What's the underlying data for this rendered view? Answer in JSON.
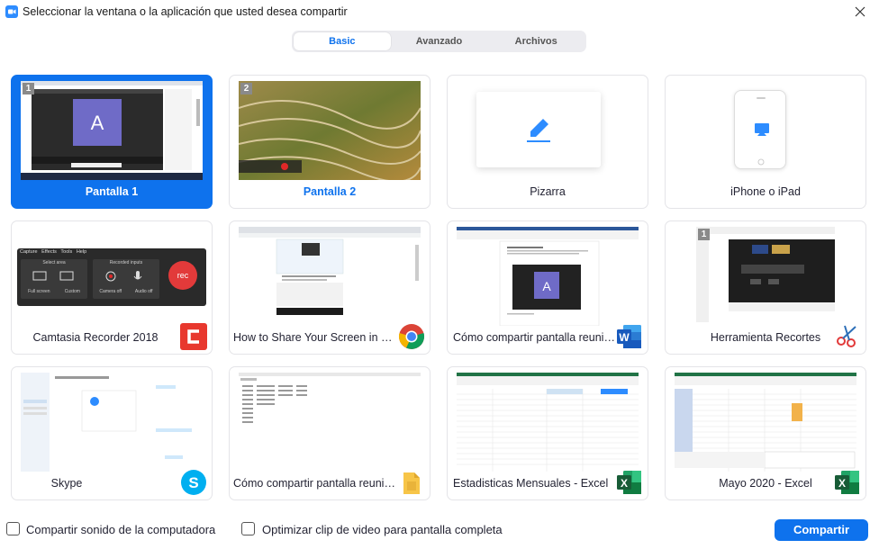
{
  "window": {
    "title": "Seleccionar la ventana o la aplicación que usted desea compartir",
    "accent_color": "#0e72ed"
  },
  "tabs": [
    {
      "label": "Basic",
      "active": true
    },
    {
      "label": "Avanzado",
      "active": false
    },
    {
      "label": "Archivos",
      "active": false
    }
  ],
  "cards": [
    {
      "label": "Pantalla 1",
      "number": "1",
      "selected": true
    },
    {
      "label": "Pantalla 2",
      "number": "2",
      "selected": false
    },
    {
      "label": "Pizarra",
      "icon": "pencil-icon"
    },
    {
      "label": "iPhone o iPad",
      "icon": "airplay-icon"
    },
    {
      "label": "Camtasia Recorder 2018",
      "app_icon": "camtasia-icon",
      "recorder": {
        "menu": [
          "Capture",
          "Effects",
          "Tools",
          "Help"
        ],
        "select_area": "Select area",
        "recorded_inputs": "Recorded inputs",
        "full_screen": "Full screen",
        "custom": "Custom",
        "camera": "Camera off",
        "audio": "Audio off",
        "rec": "rec"
      }
    },
    {
      "label": "How to Share Your Screen in a Zo...",
      "app_icon": "chrome-icon"
    },
    {
      "label": "Cómo compartir pantalla reunio...",
      "app_icon": "word-icon"
    },
    {
      "label": "Herramienta Recortes",
      "number": "1",
      "app_icon": "snipping-tool-icon"
    },
    {
      "label": "Skype",
      "app_icon": "skype-icon"
    },
    {
      "label": "Cómo compartir pantalla reunio...",
      "app_icon": "folder-icon"
    },
    {
      "label": "Estadisticas Mensuales - Excel",
      "app_icon": "excel-icon"
    },
    {
      "label": "Mayo 2020 - Excel",
      "app_icon": "excel-icon"
    }
  ],
  "footer": {
    "share_sound_label": "Compartir sonido de la computadora",
    "share_sound_checked": false,
    "optimize_video_label": "Optimizar clip de video para pantalla completa",
    "optimize_video_checked": false,
    "share_button_label": "Compartir"
  }
}
